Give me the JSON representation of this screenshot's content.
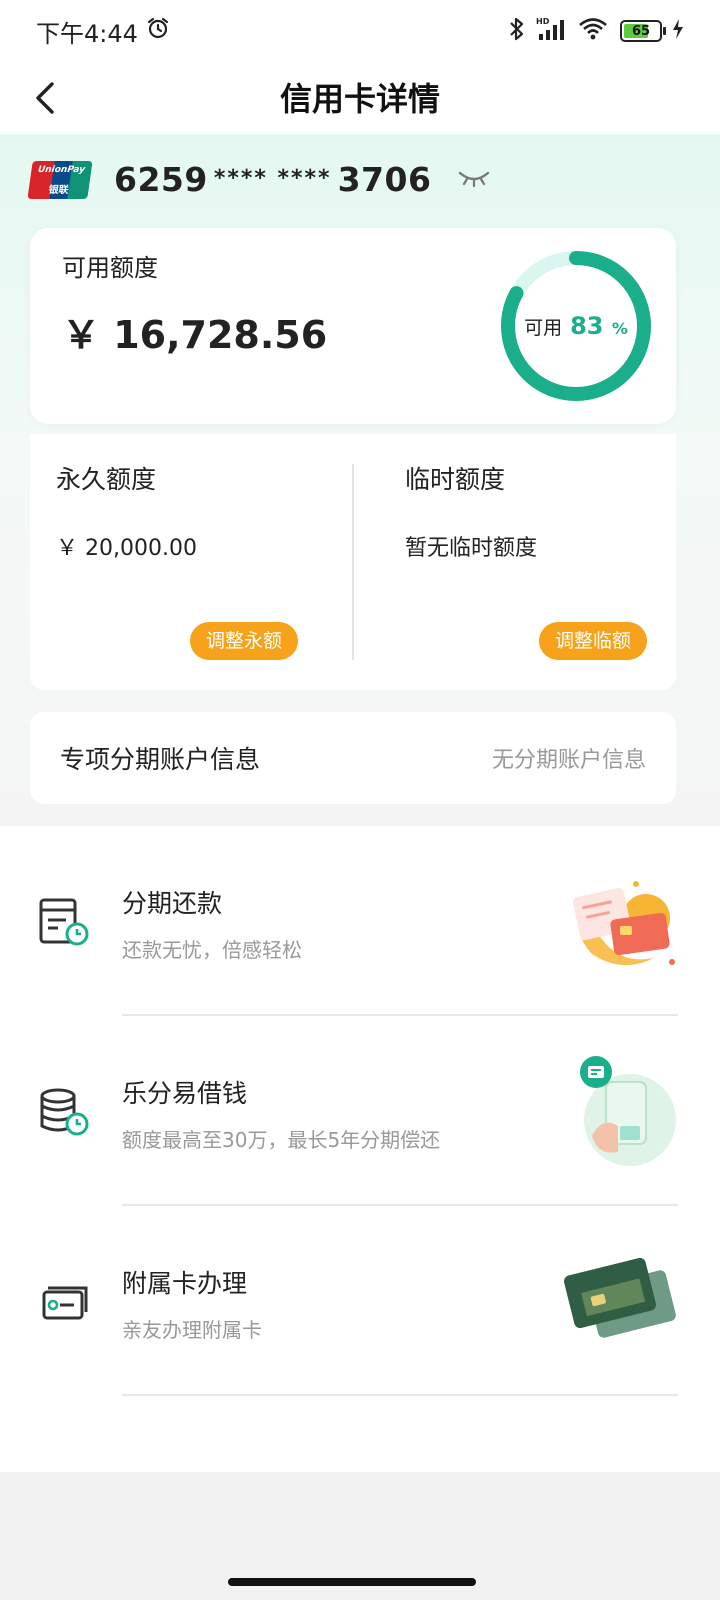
{
  "status_bar": {
    "time": "下午4:44",
    "battery_level": "65",
    "network": "HD"
  },
  "header": {
    "title": "信用卡详情"
  },
  "card": {
    "brand": "UnionPay 银联",
    "brand_en": "UnionPay",
    "brand_cn": "银联",
    "number_prefix": "6259",
    "number_mask": "**** ****",
    "number_suffix": "3706"
  },
  "available": {
    "label": "可用额度",
    "amount": "￥ 16,728.56",
    "ring_label": "可用",
    "ring_percent": "83",
    "ring_percent_unit": "%",
    "ring_fraction": 0.83,
    "ring_color": "#1aae8b",
    "ring_track_color": "#d9f7ee"
  },
  "limits": {
    "permanent": {
      "title": "永久额度",
      "value": "￥ 20,000.00",
      "button": "调整永额"
    },
    "temporary": {
      "title": "临时额度",
      "value": "暂无临时额度",
      "button": "调整临额"
    },
    "accent_color": "#f6a21a"
  },
  "installment_account": {
    "title": "专项分期账户信息",
    "value": "无分期账户信息"
  },
  "services": [
    {
      "icon": "bill-clock-icon",
      "title": "分期还款",
      "subtitle": "还款无忧，倍感轻松"
    },
    {
      "icon": "coin-stack-clock-icon",
      "title": "乐分易借钱",
      "subtitle": "额度最高至30万，最长5年分期偿还"
    },
    {
      "icon": "card-icon",
      "title": "附属卡办理",
      "subtitle": "亲友办理附属卡"
    }
  ]
}
